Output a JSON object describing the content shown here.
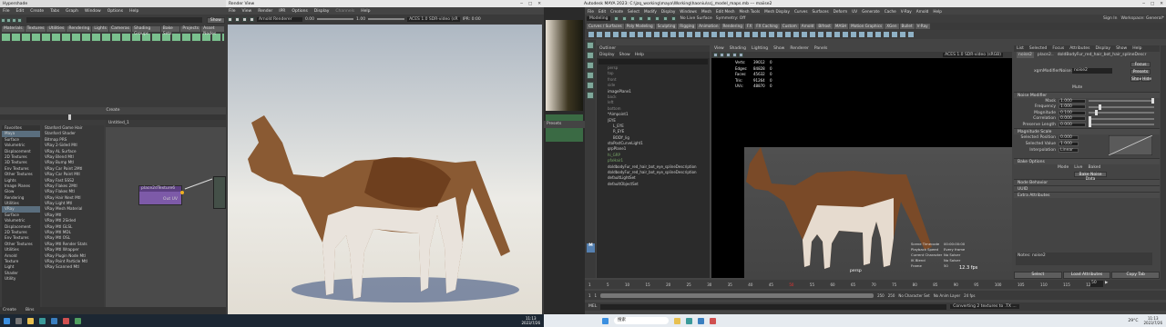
{
  "hypershade": {
    "title": "Hypershade",
    "menu": [
      "File",
      "Edit",
      "Create",
      "Tabs",
      "Graph",
      "Window",
      "Options",
      "Help"
    ],
    "show_btn": "Show",
    "shelf_tabs": [
      "Materials",
      "Textures",
      "Utilities",
      "Rendering",
      "Lights",
      "Cameras",
      "Shading Groups",
      "Bake Sets",
      "Projects",
      "Asset Nodes"
    ],
    "create_label": "Create",
    "categories": [
      "Favorites",
      "Maya",
      "Surface",
      "Volumetric",
      "Displacement",
      "2D Textures",
      "3D Textures",
      "Env Textures",
      "Other Textures",
      "Lights",
      "Image Planes",
      "Glow",
      "Rendering",
      "Utilities",
      "VRay",
      "Surface",
      "Volumetric",
      "Displacement",
      "2D Textures",
      "Env Textures",
      "Other Textures",
      "Utilities",
      "Arnold",
      "Texture",
      "Light",
      "Shader",
      "Utility"
    ],
    "nodes": [
      "Stanford Game Hair",
      "Stanford Shader",
      "Bitmap PRS",
      "VRay 2-Sided Mtl",
      "VRay AL Surface",
      "VRay Blend Mtl",
      "VRay Bump Mtl",
      "VRay Car Paint 2Mtl",
      "VRay Car Paint Mtl",
      "VRay Fast SSS2",
      "VRay Flakes 2Mtl",
      "VRay Flakes Mtl",
      "VRay Hair Next Mtl",
      "VRay Light Mtl",
      "VRay Mesh Material",
      "VRay Mtl",
      "VRay Mtl 2Sided",
      "VRay Mtl GLSL",
      "VRay Mtl MDL",
      "VRay Mtl OSL",
      "VRay Mtl Render Stats",
      "VRay Mtl Wrapper",
      "VRay Plugin Node Mtl",
      "VRay Point Particle Mtl",
      "VRay Scanned Mtl"
    ],
    "graph_tab": "Untitled_1",
    "place_node": "place2dTexture6",
    "place_port": "Out UV",
    "bottom": [
      "Create",
      "Bins"
    ]
  },
  "render_view": {
    "title": "Render View",
    "menu": [
      "File",
      "View",
      "Render",
      "IPR",
      "Options",
      "Display",
      "Channels",
      "Help"
    ],
    "renderer": "Arnold Renderer",
    "left_val": "0.00",
    "right_val": "1.00",
    "aces": "ACES 1.0 SDR-video (sR",
    "ipr": "IPR: 0:00"
  },
  "taskbar_left": {
    "time": "11:13",
    "date": "2023/7/26"
  },
  "maya": {
    "title": "Autodesk MAYA 2023: C:\\jzq_working\\maya\\Working\\haoniu\\scj_model_maps.mb  ---  maiise2",
    "menu": [
      "File",
      "Edit",
      "Create",
      "Select",
      "Modify",
      "Display",
      "Windows",
      "Mesh",
      "Edit Mesh",
      "Mesh Tools",
      "Mesh Display",
      "Curves",
      "Surfaces",
      "Deform",
      "UV",
      "Generate",
      "Cache",
      "V-Ray",
      "Arnold",
      "Help"
    ],
    "mode": "Modeling",
    "no_live": "No Live Surface",
    "symmetry": "Symmetry: Off",
    "signin": "Sign In",
    "workspace": "Workspace: General*",
    "shelf_tabs": [
      "Curves / Surfaces",
      "Poly Modeling",
      "Sculpting",
      "Rigging",
      "Animation",
      "Rendering",
      "FX",
      "FX Caching",
      "Custom",
      "Arnold",
      "Bifrost",
      "MASH",
      "Motion Graphics",
      "XGen",
      "Bullet",
      "V-Ray"
    ],
    "outliner": {
      "title": "Outliner",
      "menu": [
        "Display",
        "Show",
        "Help"
      ],
      "items": [
        "persp",
        "top",
        "front",
        "side",
        "imagePlane1",
        "back",
        "left",
        "bottom",
        "*Aimpoint1",
        "|EYE",
        "L_EYE",
        "R_EYE",
        "BODY_lig",
        "stoPostCurveLight1",
        "grpPlane1",
        "hi_GRP",
        "pfxHair1",
        "doldbodyFur_red_hair_bot_eye_splineDescription",
        "doldbodyFur_red_hair_bot_eye_splineDescription",
        "defaultLightSet",
        "defaultObjectSet"
      ]
    },
    "presets": "Presets",
    "viewport": {
      "menu": [
        "View",
        "Shading",
        "Lighting",
        "Show",
        "Renderer",
        "Panels"
      ],
      "hud_labels": [
        "Verts:",
        "Edges:",
        "Faces:",
        "Tris:",
        "UVs:"
      ],
      "hud_values": [
        "39012",
        "84828",
        "45632",
        "91264",
        "48870"
      ],
      "hud_sel": [
        "0",
        "0",
        "0",
        "0",
        "0"
      ],
      "aces": "ACES 1.0 SDR-video (sRGB)",
      "cam": "persp",
      "stats": [
        [
          "Scene Timecode",
          "00:00:00:00"
        ],
        [
          "Playback Speed",
          "Every frame"
        ],
        [
          "Current Character",
          "No Solver"
        ],
        [
          "IK Blend",
          "No Solver"
        ],
        [
          "Frame",
          "50"
        ]
      ],
      "fps": "12.3 fps"
    },
    "ae": {
      "tabs": [
        "List",
        "Selected",
        "Focus",
        "Attributes",
        "Display",
        "Show",
        "Help"
      ],
      "node_tabs": [
        "noise2",
        "place2..",
        "doldBodyFur_red_hair_bot_hair_splineDescr"
      ],
      "node_type_label": "xgmModifierNoise:",
      "node_name": "noise2",
      "btn_focus": "Focus",
      "btn_presets": "Presets",
      "btn_show": "Show",
      "btn_hide": "Hide",
      "mute": "Mute",
      "sec_modifier": "Noise Modifier",
      "attrs": [
        [
          "Mask",
          "1.000"
        ],
        [
          "Frequency",
          "1.000"
        ],
        [
          "Magnitude",
          "0.100"
        ],
        [
          "Correlation",
          "0.000"
        ],
        [
          "Preserve Length",
          "0.000"
        ]
      ],
      "sec_mag": "Magnitude Scale",
      "mag_attrs": [
        [
          "Selected Position",
          "0.000"
        ],
        [
          "Selected Value",
          "1.000"
        ],
        [
          "Interpolation",
          "Linear"
        ]
      ],
      "sec_bake": "Bake Options",
      "bake_mode": "Mode",
      "live": "Live",
      "baked": "Baked",
      "bake_btn": "Bake Noise Data",
      "secs": [
        "Node Behavior",
        "UUID",
        "Extra Attributes"
      ],
      "notes": "Notes: noise2",
      "bottom_btns": [
        "Select",
        "Load Attributes",
        "Copy Tab"
      ]
    },
    "timeline": {
      "ticks": [
        "1",
        "5",
        "10",
        "15",
        "20",
        "25",
        "30",
        "35",
        "40",
        "45",
        "50",
        "55",
        "60",
        "65",
        "70",
        "75",
        "80",
        "85",
        "90",
        "95",
        "100",
        "105",
        "110",
        "115",
        "120"
      ],
      "start": "1",
      "end": "120",
      "range_start": "1",
      "range_end": "250",
      "range_max": "250",
      "no_char": "No Character Set",
      "no_anim": "No Anim Layer",
      "fps": "24 fps",
      "frame": "50"
    },
    "cmd": {
      "mel": "MEL",
      "status": "Converting 2 textures to .TX ..."
    }
  },
  "taskbar_right": {
    "search": "搜索",
    "weather": "29°C",
    "time": "11:13",
    "date": "2023/7/26"
  }
}
